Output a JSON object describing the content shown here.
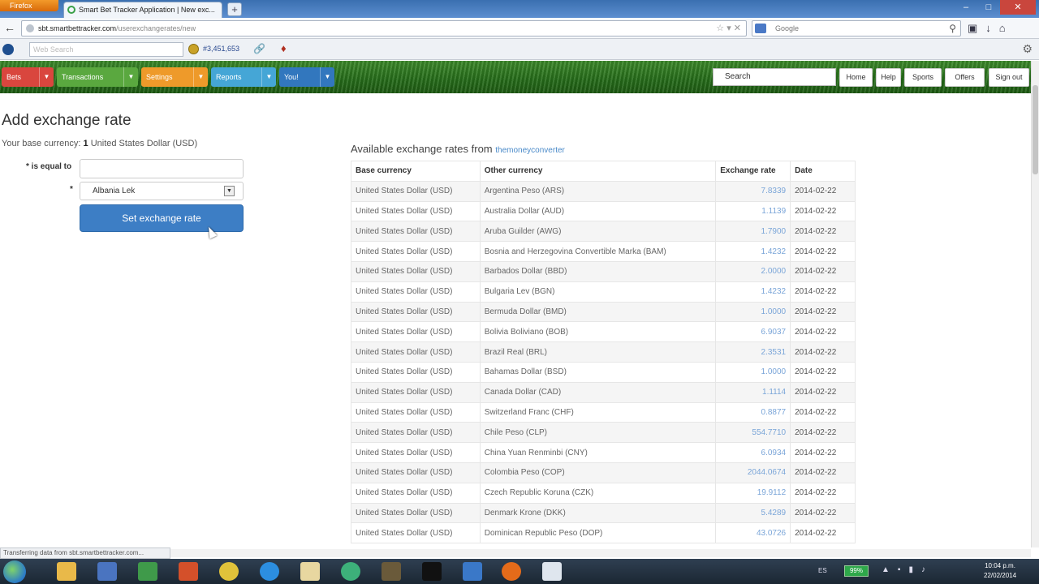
{
  "browser": {
    "menu_label": "Firefox",
    "tab_title": "Smart Bet Tracker Application | New exc...",
    "url_domain": "sbt.smartbettracker.com",
    "url_path": "/userexchangerates/new",
    "google_placeholder": "Google",
    "web_search_placeholder": "Web Search",
    "coin_count": "#3,451,653",
    "status_text": "Transferring data from sbt.smartbettracker.com..."
  },
  "site_nav": {
    "bets": "Bets",
    "transactions": "Transactions",
    "settings": "Settings",
    "reports": "Reports",
    "you": "You!",
    "search_placeholder": "Search",
    "home": "Home",
    "help": "Help",
    "sports": "Sports",
    "offers": "Offers",
    "sign_out": "Sign out"
  },
  "form": {
    "title": "Add exchange rate",
    "base_prefix": "Your base currency:",
    "base_amount": "1",
    "base_currency": "United States Dollar (USD)",
    "equal_label": "* is equal to",
    "select_star": "*",
    "selected_currency": "Albania Lek",
    "submit_label": "Set exchange rate"
  },
  "rates": {
    "heading": "Available exchange rates from",
    "source_link": "themoneyconverter",
    "columns": [
      "Base currency",
      "Other currency",
      "Exchange rate",
      "Date"
    ],
    "rows": [
      [
        "United States Dollar (USD)",
        "Argentina Peso (ARS)",
        "7.8339",
        "2014-02-22"
      ],
      [
        "United States Dollar (USD)",
        "Australia Dollar (AUD)",
        "1.1139",
        "2014-02-22"
      ],
      [
        "United States Dollar (USD)",
        "Aruba Guilder (AWG)",
        "1.7900",
        "2014-02-22"
      ],
      [
        "United States Dollar (USD)",
        "Bosnia and Herzegovina Convertible Marka (BAM)",
        "1.4232",
        "2014-02-22"
      ],
      [
        "United States Dollar (USD)",
        "Barbados Dollar (BBD)",
        "2.0000",
        "2014-02-22"
      ],
      [
        "United States Dollar (USD)",
        "Bulgaria Lev (BGN)",
        "1.4232",
        "2014-02-22"
      ],
      [
        "United States Dollar (USD)",
        "Bermuda Dollar (BMD)",
        "1.0000",
        "2014-02-22"
      ],
      [
        "United States Dollar (USD)",
        "Bolivia Boliviano (BOB)",
        "6.9037",
        "2014-02-22"
      ],
      [
        "United States Dollar (USD)",
        "Brazil Real (BRL)",
        "2.3531",
        "2014-02-22"
      ],
      [
        "United States Dollar (USD)",
        "Bahamas Dollar (BSD)",
        "1.0000",
        "2014-02-22"
      ],
      [
        "United States Dollar (USD)",
        "Canada Dollar (CAD)",
        "1.1114",
        "2014-02-22"
      ],
      [
        "United States Dollar (USD)",
        "Switzerland Franc (CHF)",
        "0.8877",
        "2014-02-22"
      ],
      [
        "United States Dollar (USD)",
        "Chile Peso (CLP)",
        "554.7710",
        "2014-02-22"
      ],
      [
        "United States Dollar (USD)",
        "China Yuan Renminbi (CNY)",
        "6.0934",
        "2014-02-22"
      ],
      [
        "United States Dollar (USD)",
        "Colombia Peso (COP)",
        "2044.0674",
        "2014-02-22"
      ],
      [
        "United States Dollar (USD)",
        "Czech Republic Koruna (CZK)",
        "19.9112",
        "2014-02-22"
      ],
      [
        "United States Dollar (USD)",
        "Denmark Krone (DKK)",
        "5.4289",
        "2014-02-22"
      ],
      [
        "United States Dollar (USD)",
        "Dominican Republic Peso (DOP)",
        "43.0726",
        "2014-02-22"
      ]
    ]
  },
  "taskbar": {
    "battery": "99%",
    "language": "ES",
    "time": "10:04 p.m.",
    "date": "22/02/2014"
  },
  "colors": {
    "primary_button": "#3d7ec5",
    "bets": "#d9463e",
    "transactions": "#5aa83f",
    "settings": "#ee9a2a",
    "reports": "#45a6d6",
    "you": "#3277be",
    "rate_link": "#7aa5d8"
  }
}
